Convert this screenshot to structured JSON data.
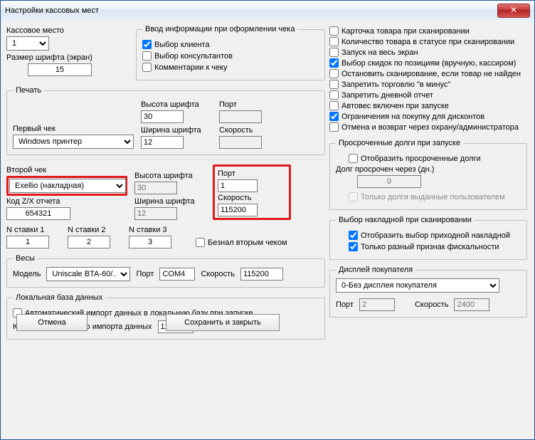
{
  "window": {
    "title": "Настройки кассовых мест"
  },
  "left": {
    "cashPlaceLabel": "Кассовое место",
    "cashPlaceValue": "1",
    "fontSizeLabel": "Размер шрифта (экран)",
    "fontSizeValue": "15"
  },
  "receiptInput": {
    "legend": "Ввод информации при оформлении чека",
    "chooseClient": "Выбор клиента",
    "chooseConsultants": "Выбор консультантов",
    "receiptComments": "Комментарии к чеку"
  },
  "print": {
    "legend": "Печать",
    "first": {
      "label": "Первый чек",
      "printer": "Windows принтер",
      "fontHeightLabel": "Высота шрифта",
      "fontHeight": "30",
      "fontWidthLabel": "Ширина шрифта",
      "fontWidth": "12",
      "portLabel": "Порт",
      "port": "",
      "speedLabel": "Скорость",
      "speed": ""
    },
    "second": {
      "label": "Второй чек",
      "printer": "Exellio (накладная)",
      "zxLabel": "Код Z/X отчета",
      "zx": "654321",
      "fontHeightLabel": "Высота шрифта",
      "fontHeight": "30",
      "fontWidthLabel": "Ширина шрифта",
      "fontWidth": "12",
      "portLabel": "Порт",
      "port": "1",
      "speedLabel": "Скорость",
      "speed": "115200",
      "rate1Label": "N ставки 1",
      "rate1": "1",
      "rate2Label": "N ставки 2",
      "rate2": "2",
      "rate3Label": "N ставки 3",
      "rate3": "3",
      "cashlessSecond": "Безнал вторым чеком"
    }
  },
  "scales": {
    "legend": "Весы",
    "modelLabel": "Модель",
    "model": "Uniscale BTA-60/...",
    "portLabel": "Порт",
    "port": "COM4",
    "speedLabel": "Скорость",
    "speed": "115200"
  },
  "localDb": {
    "legend": "Локальная база данных",
    "autoImport": "Автоматический импорт данных в локальную базу при запуске",
    "forceCodeLabel": "Код принудительного импорта данных",
    "forceCode": "1111"
  },
  "buttons": {
    "cancel": "Отмена",
    "save": "Сохранить и закрыть"
  },
  "rightChecks": {
    "c1": "Карточка товара при сканировании",
    "c2": "Количество товара в статусе при сканировании",
    "c3": "Запуск на весь экран",
    "c4": "Выбор скидок по позициям (вручную, кассиром)",
    "c5": "Остановить сканирование, если товар не найден",
    "c6": "Запретить торговлю \"в минус\"",
    "c7": "Запретить дневной отчет",
    "c8": "Автовес включен при запуске",
    "c9": "Ограничения на покупку для дисконтов",
    "c10": "Отмена и возврат через охрану/администратора"
  },
  "debts": {
    "legend": "Просроченные долги при запуске",
    "show": "Отобразить просроченные долги",
    "afterLabel": "Долг просрочен через (дн.)",
    "after": "0",
    "onlyUser": "Только долги выданные пользователем"
  },
  "invoice": {
    "legend": "Выбор накладной при сканировании",
    "show": "Отобразить выбор приходной накладной",
    "onlyDiff": "Только разный признак фискальности"
  },
  "display": {
    "legend": "Дисплей покупателя",
    "value": "0-Без дисплея покупателя",
    "portLabel": "Порт",
    "port": "2",
    "speedLabel": "Скорость",
    "speed": "2400"
  }
}
